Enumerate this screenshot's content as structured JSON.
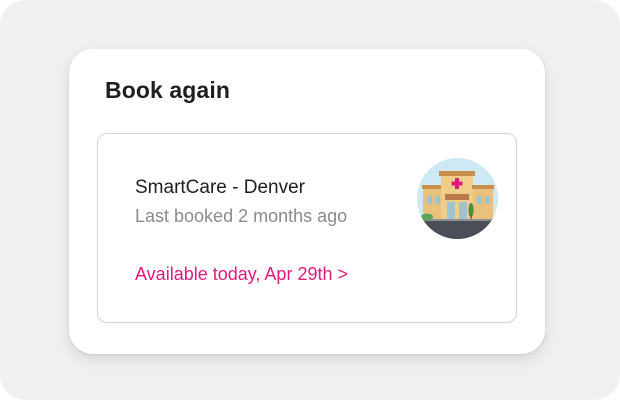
{
  "card": {
    "title": "Book again"
  },
  "provider": {
    "name": "SmartCare - Denver",
    "last_booked": "Last booked 2 months ago",
    "availability_link": "Available today, Apr 29th >",
    "image_icon": "clinic-building-icon"
  },
  "colors": {
    "accent": "#e2197c",
    "background": "#f1f0ee",
    "secondary_text": "#8a8a91",
    "primary_text": "#1f1f23"
  }
}
